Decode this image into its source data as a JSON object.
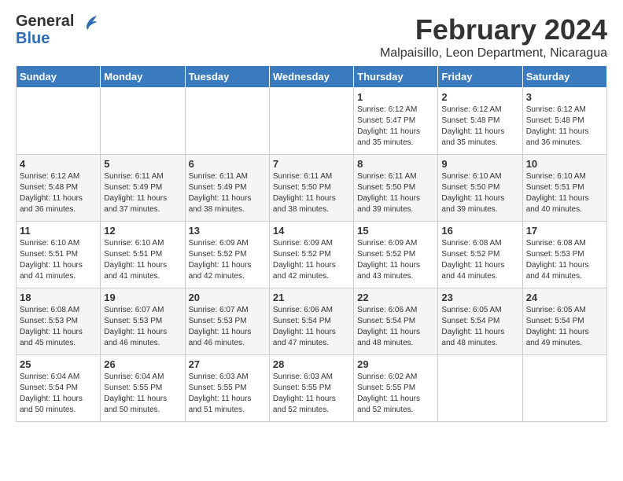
{
  "logo": {
    "general": "General",
    "blue": "Blue"
  },
  "header": {
    "month": "February 2024",
    "location": "Malpaisillo, Leon Department, Nicaragua"
  },
  "weekdays": [
    "Sunday",
    "Monday",
    "Tuesday",
    "Wednesday",
    "Thursday",
    "Friday",
    "Saturday"
  ],
  "weeks": [
    [
      {
        "day": "",
        "info": ""
      },
      {
        "day": "",
        "info": ""
      },
      {
        "day": "",
        "info": ""
      },
      {
        "day": "",
        "info": ""
      },
      {
        "day": "1",
        "info": "Sunrise: 6:12 AM\nSunset: 5:47 PM\nDaylight: 11 hours\nand 35 minutes."
      },
      {
        "day": "2",
        "info": "Sunrise: 6:12 AM\nSunset: 5:48 PM\nDaylight: 11 hours\nand 35 minutes."
      },
      {
        "day": "3",
        "info": "Sunrise: 6:12 AM\nSunset: 5:48 PM\nDaylight: 11 hours\nand 36 minutes."
      }
    ],
    [
      {
        "day": "4",
        "info": "Sunrise: 6:12 AM\nSunset: 5:48 PM\nDaylight: 11 hours\nand 36 minutes."
      },
      {
        "day": "5",
        "info": "Sunrise: 6:11 AM\nSunset: 5:49 PM\nDaylight: 11 hours\nand 37 minutes."
      },
      {
        "day": "6",
        "info": "Sunrise: 6:11 AM\nSunset: 5:49 PM\nDaylight: 11 hours\nand 38 minutes."
      },
      {
        "day": "7",
        "info": "Sunrise: 6:11 AM\nSunset: 5:50 PM\nDaylight: 11 hours\nand 38 minutes."
      },
      {
        "day": "8",
        "info": "Sunrise: 6:11 AM\nSunset: 5:50 PM\nDaylight: 11 hours\nand 39 minutes."
      },
      {
        "day": "9",
        "info": "Sunrise: 6:10 AM\nSunset: 5:50 PM\nDaylight: 11 hours\nand 39 minutes."
      },
      {
        "day": "10",
        "info": "Sunrise: 6:10 AM\nSunset: 5:51 PM\nDaylight: 11 hours\nand 40 minutes."
      }
    ],
    [
      {
        "day": "11",
        "info": "Sunrise: 6:10 AM\nSunset: 5:51 PM\nDaylight: 11 hours\nand 41 minutes."
      },
      {
        "day": "12",
        "info": "Sunrise: 6:10 AM\nSunset: 5:51 PM\nDaylight: 11 hours\nand 41 minutes."
      },
      {
        "day": "13",
        "info": "Sunrise: 6:09 AM\nSunset: 5:52 PM\nDaylight: 11 hours\nand 42 minutes."
      },
      {
        "day": "14",
        "info": "Sunrise: 6:09 AM\nSunset: 5:52 PM\nDaylight: 11 hours\nand 42 minutes."
      },
      {
        "day": "15",
        "info": "Sunrise: 6:09 AM\nSunset: 5:52 PM\nDaylight: 11 hours\nand 43 minutes."
      },
      {
        "day": "16",
        "info": "Sunrise: 6:08 AM\nSunset: 5:52 PM\nDaylight: 11 hours\nand 44 minutes."
      },
      {
        "day": "17",
        "info": "Sunrise: 6:08 AM\nSunset: 5:53 PM\nDaylight: 11 hours\nand 44 minutes."
      }
    ],
    [
      {
        "day": "18",
        "info": "Sunrise: 6:08 AM\nSunset: 5:53 PM\nDaylight: 11 hours\nand 45 minutes."
      },
      {
        "day": "19",
        "info": "Sunrise: 6:07 AM\nSunset: 5:53 PM\nDaylight: 11 hours\nand 46 minutes."
      },
      {
        "day": "20",
        "info": "Sunrise: 6:07 AM\nSunset: 5:53 PM\nDaylight: 11 hours\nand 46 minutes."
      },
      {
        "day": "21",
        "info": "Sunrise: 6:06 AM\nSunset: 5:54 PM\nDaylight: 11 hours\nand 47 minutes."
      },
      {
        "day": "22",
        "info": "Sunrise: 6:06 AM\nSunset: 5:54 PM\nDaylight: 11 hours\nand 48 minutes."
      },
      {
        "day": "23",
        "info": "Sunrise: 6:05 AM\nSunset: 5:54 PM\nDaylight: 11 hours\nand 48 minutes."
      },
      {
        "day": "24",
        "info": "Sunrise: 6:05 AM\nSunset: 5:54 PM\nDaylight: 11 hours\nand 49 minutes."
      }
    ],
    [
      {
        "day": "25",
        "info": "Sunrise: 6:04 AM\nSunset: 5:54 PM\nDaylight: 11 hours\nand 50 minutes."
      },
      {
        "day": "26",
        "info": "Sunrise: 6:04 AM\nSunset: 5:55 PM\nDaylight: 11 hours\nand 50 minutes."
      },
      {
        "day": "27",
        "info": "Sunrise: 6:03 AM\nSunset: 5:55 PM\nDaylight: 11 hours\nand 51 minutes."
      },
      {
        "day": "28",
        "info": "Sunrise: 6:03 AM\nSunset: 5:55 PM\nDaylight: 11 hours\nand 52 minutes."
      },
      {
        "day": "29",
        "info": "Sunrise: 6:02 AM\nSunset: 5:55 PM\nDaylight: 11 hours\nand 52 minutes."
      },
      {
        "day": "",
        "info": ""
      },
      {
        "day": "",
        "info": ""
      }
    ]
  ]
}
